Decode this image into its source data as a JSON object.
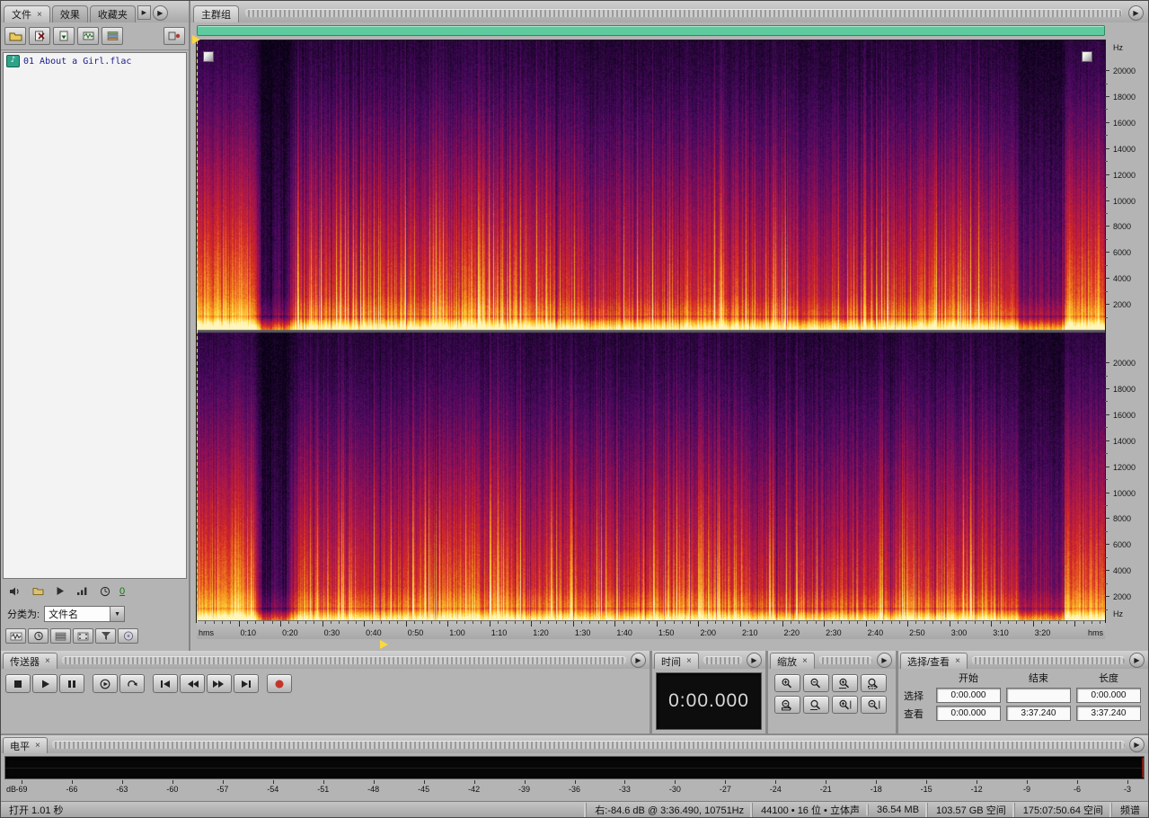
{
  "colors": {
    "nav_bar_green": "#5ecb9e",
    "record_red": "#c3352b",
    "file_link_blue": "#1c1c8c",
    "time_display_text": "#d8d8d8",
    "spectrogram_palette": [
      "#060212",
      "#4b0a62",
      "#9c1254",
      "#d62a26",
      "#f58c1e",
      "#ffd83c",
      "#fff6be"
    ]
  },
  "files_panel": {
    "tabs": [
      {
        "label": "文件"
      },
      {
        "label": "效果"
      },
      {
        "label": "收藏夹"
      }
    ],
    "file_list": [
      {
        "name": "01 About a Girl.flac",
        "icon": "audio-file-icon"
      }
    ],
    "loop_count": "0",
    "sort_label": "分类为:",
    "sort_value": "文件名"
  },
  "main": {
    "tab": "主群组",
    "freq_unit": "Hz",
    "freq_labels": [
      "20000",
      "18000",
      "16000",
      "14000",
      "12000",
      "10000",
      "8000",
      "6000",
      "4000",
      "2000"
    ],
    "timeline": {
      "left_label": "hms",
      "right_label": "hms",
      "tick_labels": [
        "0:10",
        "0:20",
        "0:30",
        "0:40",
        "0:50",
        "1:00",
        "1:10",
        "1:20",
        "1:30",
        "1:40",
        "1:50",
        "2:00",
        "2:10",
        "2:20",
        "2:30",
        "2:40",
        "2:50",
        "3:00",
        "3:10",
        "3:20"
      ]
    }
  },
  "transport": {
    "title": "传送器",
    "buttons": [
      "stop",
      "play",
      "pause",
      "play-from-cursor",
      "loop-play",
      "go-to-beginning",
      "rewind",
      "fast-forward",
      "go-to-end",
      "record"
    ]
  },
  "time_panel": {
    "title": "时间",
    "value": "0:00.000"
  },
  "zoom_panel": {
    "title": "缩放",
    "buttons": [
      "zoom-in",
      "zoom-out",
      "zoom-in-horizontal",
      "zoom-to-selection",
      "zoom-out-full",
      "zoom-horizontal",
      "zoom-in-vertical",
      "zoom-out-vertical"
    ]
  },
  "selection_panel": {
    "title": "选择/查看",
    "columns": [
      "开始",
      "结束",
      "长度"
    ],
    "rows": [
      {
        "label": "选择",
        "start": "0:00.000",
        "end": "",
        "length": "0:00.000"
      },
      {
        "label": "查看",
        "start": "0:00.000",
        "end": "3:37.240",
        "length": "3:37.240"
      }
    ]
  },
  "levels_panel": {
    "title": "电平",
    "db_unit": "dB",
    "db_labels": [
      "-69",
      "-66",
      "-63",
      "-60",
      "-57",
      "-54",
      "-51",
      "-48",
      "-45",
      "-42",
      "-39",
      "-36",
      "-33",
      "-30",
      "-27",
      "-24",
      "-21",
      "-18",
      "-15",
      "-12",
      "-9",
      "-6",
      "-3"
    ]
  },
  "status_bar": {
    "open_time": "打开 1.01 秒",
    "cursor_info": "右:-84.6 dB @ 3:36.490, 10751Hz",
    "format_info": "44100 • 16 位 • 立体声",
    "file_size": "36.54 MB",
    "disk_space": "103.57 GB 空间",
    "disk_time": "175:07:50.64 空间",
    "view_mode": "频谱"
  }
}
